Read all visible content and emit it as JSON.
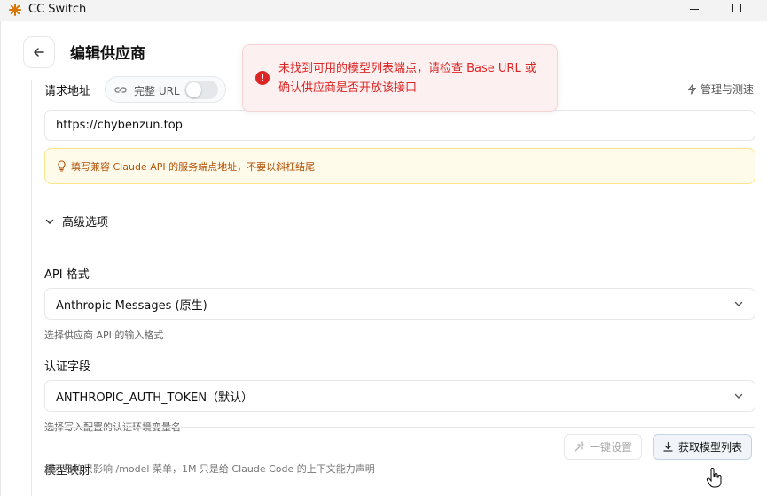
{
  "app": {
    "title": "CC Switch"
  },
  "header": {
    "title": "编辑供应商"
  },
  "request": {
    "label": "请求地址",
    "full_url_label": "完整 URL",
    "full_url_enabled": false,
    "manage_label": "管理与测速",
    "url_value": "https://chybenzun.top",
    "hint": "填写兼容 Claude API 的服务端点地址，不要以斜杠结尾"
  },
  "advanced": {
    "label": "高级选项"
  },
  "api_format": {
    "label": "API 格式",
    "selected": "Anthropic Messages (原生)",
    "desc": "选择供应商 API 的输入格式"
  },
  "auth_field": {
    "label": "认证字段",
    "selected": "ANTHROPIC_AUTH_TOKEN（默认）",
    "desc": "选择写入配置的认证环境变量名"
  },
  "model_mapping": {
    "label": "模型映射",
    "one_click_label": "一键设置",
    "fetch_label": "获取模型列表",
    "desc_partial": "显示名称只影响 /model 菜单，1M 只是给 Claude Code 的上下文能力声明"
  },
  "toast": {
    "message": "未找到可用的模型列表端点，请检查 Base URL 或确认供应商是否开放该接口"
  },
  "colors": {
    "error": "#dc2626",
    "hint_text": "#b45309",
    "hint_bg": "#fffbeb"
  },
  "icons": [
    "app-logo-icon",
    "back-arrow-icon",
    "link-icon",
    "lightning-icon",
    "bulb-icon",
    "chevron-down-icon",
    "wand-icon",
    "download-icon",
    "error-icon",
    "hand-cursor-icon"
  ]
}
